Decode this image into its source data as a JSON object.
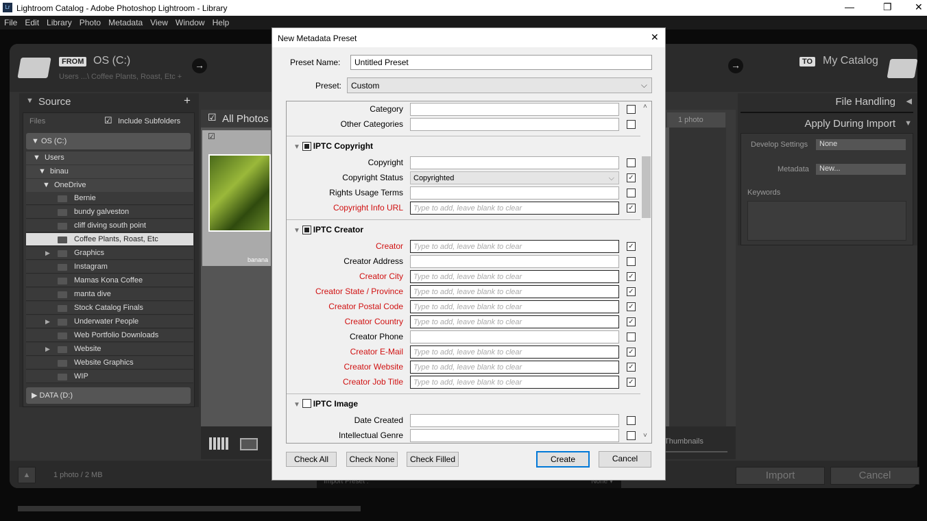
{
  "window": {
    "title": "Lightroom Catalog - Adobe Photoshop Lightroom - Library",
    "app_icon": "Lr",
    "controls": [
      "—",
      "❐",
      "✕"
    ]
  },
  "menu": [
    "File",
    "Edit",
    "Library",
    "Photo",
    "Metadata",
    "View",
    "Window",
    "Help"
  ],
  "header": {
    "from_badge": "FROM",
    "source": "OS (C:)",
    "source_path": "Users ...\\ Coffee Plants, Roast, Etc +",
    "to_badge": "TO",
    "destination": "My Catalog",
    "arrow": "→"
  },
  "source_panel": {
    "title": "Source",
    "add": "+",
    "files_label": "Files",
    "include_subfolders": "Include Subfolders",
    "include_checked": true,
    "drive_c": "OS (C:)",
    "users": "Users",
    "user": "binau",
    "onedrive": "OneDrive",
    "folders": [
      {
        "name": "Bernie",
        "expand": false
      },
      {
        "name": "bundy galveston",
        "expand": false
      },
      {
        "name": "cliff diving south point",
        "expand": false
      },
      {
        "name": "Coffee Plants, Roast, Etc",
        "expand": false,
        "selected": true
      },
      {
        "name": "Graphics",
        "expand": true
      },
      {
        "name": "Instagram",
        "expand": false
      },
      {
        "name": "Mamas Kona Coffee",
        "expand": false
      },
      {
        "name": "manta dive",
        "expand": false
      },
      {
        "name": "Stock Catalog Finals",
        "expand": false
      },
      {
        "name": "Underwater People",
        "expand": true
      },
      {
        "name": "Web Portfolio Downloads",
        "expand": false
      },
      {
        "name": "Website",
        "expand": true
      },
      {
        "name": "Website Graphics",
        "expand": false
      },
      {
        "name": "WIP",
        "expand": false
      }
    ],
    "drive_d": "DATA (D:)"
  },
  "grid": {
    "all_photos": "All Photos",
    "photo_count": "1 photo",
    "thumb_label": "banana",
    "thumbnails_label": "Thumbnails"
  },
  "right_panel": {
    "file_handling": "File Handling",
    "apply_during_import": "Apply During Import",
    "develop_label": "Develop Settings",
    "develop_value": "None",
    "metadata_label": "Metadata",
    "metadata_value": "New...",
    "keywords_label": "Keywords"
  },
  "footer": {
    "summary": "1 photo / 2 MB",
    "import": "Import",
    "cancel": "Cancel",
    "import_preset": "Import Preset :",
    "preset_value": "None ▾"
  },
  "dialog": {
    "title": "New Metadata Preset",
    "close": "✕",
    "preset_name_label": "Preset Name:",
    "preset_name": "Untitled Preset",
    "preset_label": "Preset:",
    "preset_value": "Custom",
    "placeholder": "Type to add, leave blank to clear",
    "sections": [
      {
        "title": "",
        "fields": [
          {
            "label": "Category",
            "checked": false
          },
          {
            "label": "Other Categories",
            "checked": false
          }
        ]
      },
      {
        "title": "IPTC Copyright",
        "state": "mixed",
        "fields": [
          {
            "label": "Copyright",
            "checked": false
          },
          {
            "label": "Copyright Status",
            "value": "Copyrighted",
            "select": true,
            "checked": true
          },
          {
            "label": "Rights Usage Terms",
            "checked": false
          },
          {
            "label": "Copyright Info URL",
            "required": true,
            "checked": true
          }
        ]
      },
      {
        "title": "IPTC Creator",
        "state": "mixed",
        "fields": [
          {
            "label": "Creator",
            "required": true,
            "checked": true
          },
          {
            "label": "Creator Address",
            "checked": false
          },
          {
            "label": "Creator City",
            "required": true,
            "checked": true
          },
          {
            "label": "Creator State / Province",
            "required": true,
            "checked": true
          },
          {
            "label": "Creator Postal Code",
            "required": true,
            "checked": true
          },
          {
            "label": "Creator Country",
            "required": true,
            "checked": true
          },
          {
            "label": "Creator Phone",
            "checked": false
          },
          {
            "label": "Creator E-Mail",
            "required": true,
            "checked": true
          },
          {
            "label": "Creator Website",
            "required": true,
            "checked": true
          },
          {
            "label": "Creator Job Title",
            "required": true,
            "checked": true
          }
        ]
      },
      {
        "title": "IPTC Image",
        "state": "unchecked",
        "fields": [
          {
            "label": "Date Created",
            "checked": false
          },
          {
            "label": "Intellectual Genre",
            "checked": false
          }
        ]
      }
    ],
    "check_all": "Check All",
    "check_none": "Check None",
    "check_filled": "Check Filled",
    "create": "Create",
    "cancel": "Cancel"
  },
  "colors": {
    "required_label": "#d01010",
    "accent_button": "#0078d7"
  }
}
